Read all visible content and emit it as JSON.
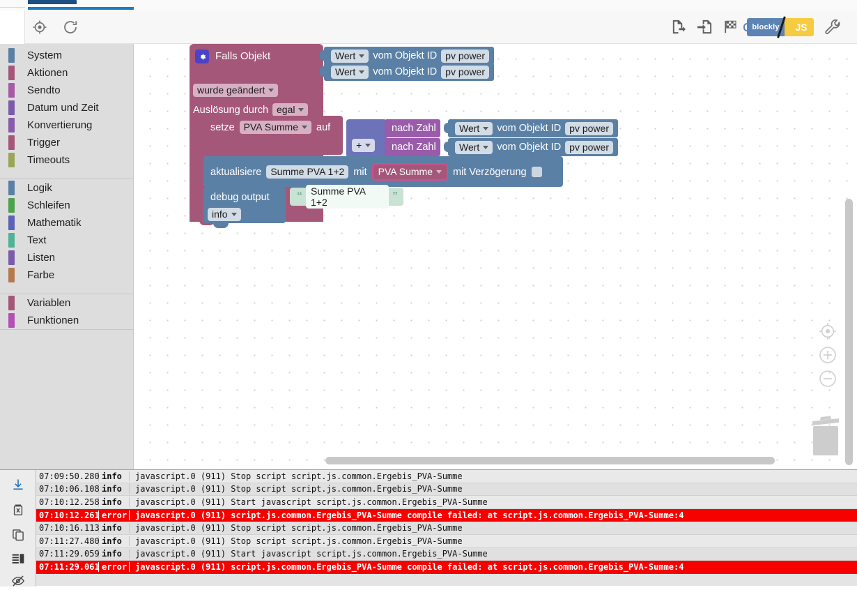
{
  "toolbar": {
    "icons": [
      {
        "name": "center-blocks-icon",
        "title": "Center"
      },
      {
        "name": "reload-icon",
        "title": "Reload"
      },
      {
        "name": "export-blocks-icon",
        "title": "Export"
      },
      {
        "name": "import-blocks-icon",
        "title": "Import"
      },
      {
        "name": "checkered-flag-icon",
        "title": "Checkpoint"
      },
      {
        "name": "wrench-icon",
        "title": "Settings"
      }
    ],
    "language_toggle": {
      "left_label": "blockly",
      "right_label": "JS",
      "left_color": "#5c83b4",
      "right_color": "#f7cb3f"
    }
  },
  "sidebar": {
    "groups": [
      {
        "items": [
          {
            "label": "System",
            "color": "#5b80a5"
          },
          {
            "label": "Aktionen",
            "color": "#a5577a"
          },
          {
            "label": "Sendto",
            "color": "#a85ba5"
          },
          {
            "label": "Datum und Zeit",
            "color": "#7b5bab"
          },
          {
            "label": "Konvertierung",
            "color": "#8a5bab"
          },
          {
            "label": "Trigger",
            "color": "#a5577a"
          },
          {
            "label": "Timeouts",
            "color": "#9aa558"
          }
        ]
      },
      {
        "items": [
          {
            "label": "Logik",
            "color": "#5b80a5"
          },
          {
            "label": "Schleifen",
            "color": "#4ba34b"
          },
          {
            "label": "Mathematik",
            "color": "#5b62b8"
          },
          {
            "label": "Text",
            "color": "#4fb396"
          },
          {
            "label": "Listen",
            "color": "#7b5bab"
          },
          {
            "label": "Farbe",
            "color": "#b5794f"
          }
        ]
      },
      {
        "items": [
          {
            "label": "Variablen",
            "color": "#a5577a"
          },
          {
            "label": "Funktionen",
            "color": "#b44fb4"
          }
        ]
      }
    ]
  },
  "workspace": {
    "event_block": {
      "title": "Falls Objekt",
      "gear_icon": "gear-icon",
      "changed_dropdown": "wurde geändert",
      "trigger_label": "Auslösung durch",
      "trigger_dropdown": "egal",
      "color": "#a5577a"
    },
    "get_object_blocks": [
      {
        "value_dropdown": "Wert",
        "label": "vom Objekt ID",
        "object_id": "pv power"
      },
      {
        "value_dropdown": "Wert",
        "label": "vom Objekt ID",
        "object_id": "pv power"
      }
    ],
    "set_block": {
      "keyword": "setze",
      "variable": "PVA Summe",
      "to_label": "auf",
      "color": "#a5577a"
    },
    "math_block": {
      "operator": "+",
      "color": "#6d73b8"
    },
    "convert_blocks": [
      {
        "label": "nach Zahl",
        "color": "#9a5bab"
      },
      {
        "label": "nach Zahl",
        "color": "#9a5bab"
      }
    ],
    "inner_get_object_blocks": [
      {
        "value_dropdown": "Wert",
        "label": "vom Objekt ID",
        "object_id": "pv power"
      },
      {
        "value_dropdown": "Wert",
        "label": "vom Objekt ID",
        "object_id": "pv power"
      }
    ],
    "update_block": {
      "keyword": "aktualisiere",
      "target": "Summe PVA 1+2",
      "with_label": "mit",
      "value_variable": "PVA Summe",
      "delay_label": "mit Verzögerung",
      "delay_checked": false,
      "color": "#5b80a5"
    },
    "debug_block": {
      "keyword": "debug output",
      "level": "info",
      "color": "#5b80a5"
    },
    "text_block": {
      "text": "Summe PVA 1+2",
      "color": "#c8e2d4"
    },
    "controls": [
      {
        "name": "center-workspace-icon"
      },
      {
        "name": "zoom-in-icon"
      },
      {
        "name": "zoom-out-icon"
      },
      {
        "name": "trash-icon"
      }
    ]
  },
  "log": {
    "tool_icons": [
      {
        "name": "download-log-icon"
      },
      {
        "name": "delete-log-icon"
      },
      {
        "name": "copy-log-icon"
      },
      {
        "name": "log-list-icon"
      },
      {
        "name": "hide-log-icon"
      }
    ],
    "rows": [
      {
        "time": "07:09:50.280",
        "level": "info",
        "message": "javascript.0 (911) Stop script script.js.common.Ergebis_PVA-Summe"
      },
      {
        "time": "07:10:06.108",
        "level": "info",
        "message": "javascript.0 (911) Stop script script.js.common.Ergebis_PVA-Summe"
      },
      {
        "time": "07:10:12.258",
        "level": "info",
        "message": "javascript.0 (911) Start javascript script.js.common.Ergebis_PVA-Summe"
      },
      {
        "time": "07:10:12.261",
        "level": "error",
        "message": "javascript.0 (911) script.js.common.Ergebis_PVA-Summe compile failed: at script.js.common.Ergebis_PVA-Summe:4"
      },
      {
        "time": "07:10:16.113",
        "level": "info",
        "message": "javascript.0 (911) Stop script script.js.common.Ergebis_PVA-Summe"
      },
      {
        "time": "07:11:27.480",
        "level": "info",
        "message": "javascript.0 (911) Stop script script.js.common.Ergebis_PVA-Summe"
      },
      {
        "time": "07:11:29.059",
        "level": "info",
        "message": "javascript.0 (911) Start javascript script.js.common.Ergebis_PVA-Summe"
      },
      {
        "time": "07:11:29.061",
        "level": "error",
        "message": "javascript.0 (911) script.js.common.Ergebis_PVA-Summe compile failed: at script.js.common.Ergebis_PVA-Summe:4"
      }
    ]
  }
}
